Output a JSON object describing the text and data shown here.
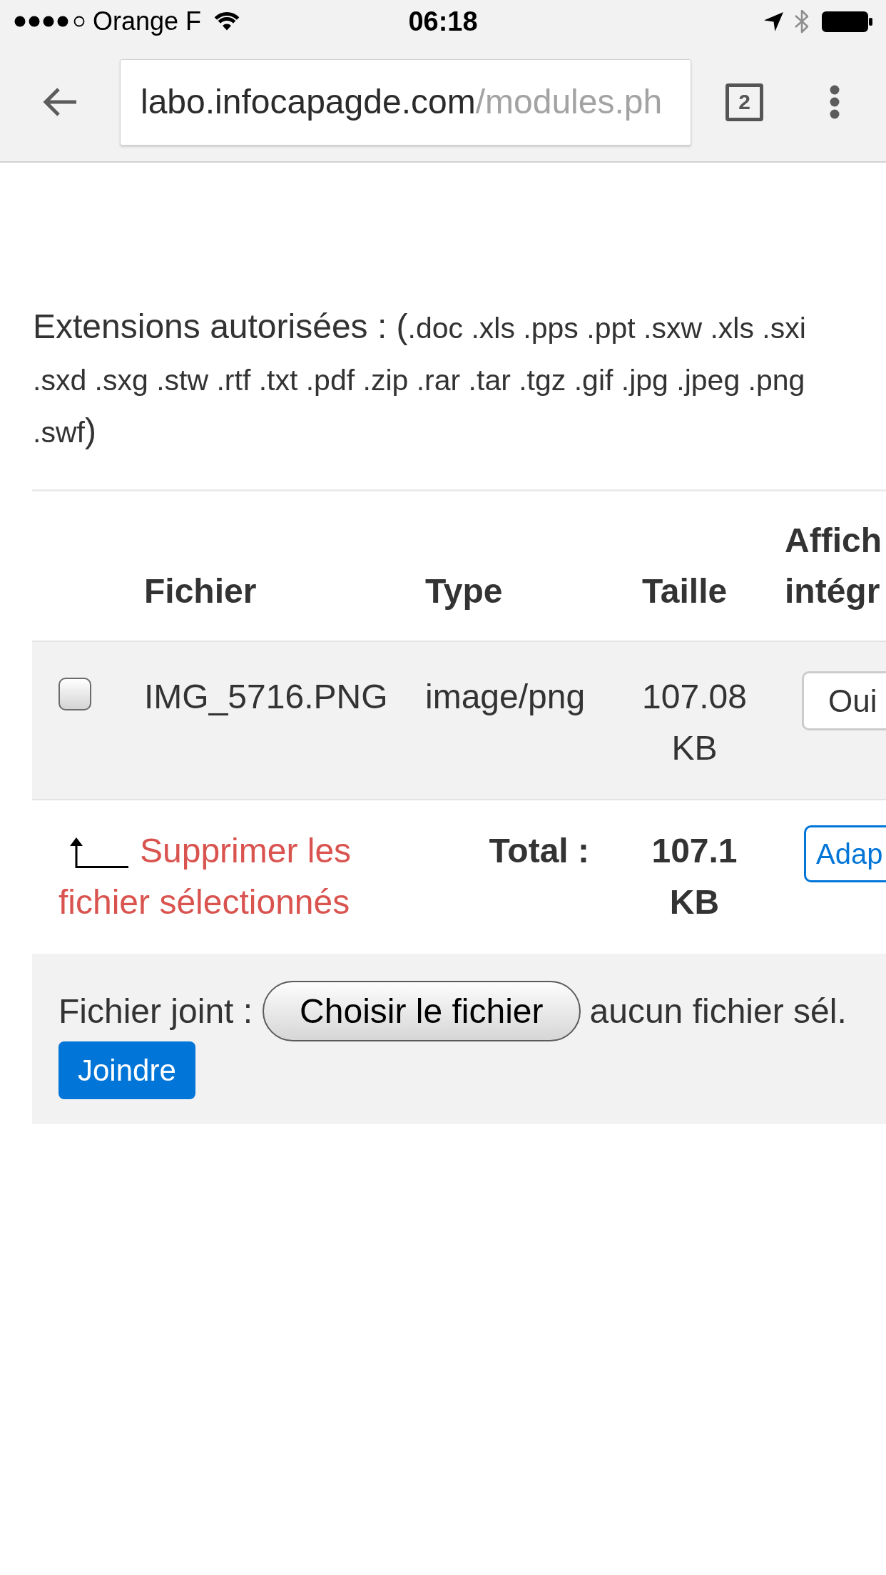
{
  "status_bar": {
    "carrier": "Orange F",
    "time": "06:18"
  },
  "browser": {
    "url": {
      "host": "labo.infocapagde.com",
      "path": "/modules.ph"
    },
    "tab_count": "2"
  },
  "extensions": {
    "label": "Extensions autorisées : (",
    "list": ".doc .xls .pps .ppt .sxw .xls .sxi .sxd .sxg .stw .rtf .txt .pdf .zip .rar .tar .tgz .gif .jpg .jpeg .png .swf",
    "closing": ")"
  },
  "table": {
    "columns": [
      "Fichier",
      "Type",
      "Taille",
      "Affich intégr"
    ],
    "rows": [
      {
        "checked": false,
        "file": "IMG_5716.PNG",
        "type": "image/png",
        "size": "107.08 KB",
        "button": "Oui"
      }
    ],
    "footer": {
      "delete_link": "Supprimer les fichier sélectionnés",
      "total_label": "Total :",
      "total": "107.1 KB",
      "button": "Adap"
    }
  },
  "upload": {
    "label": "Fichier joint :",
    "choose_button": "Choisir le fichier",
    "file_status": "aucun fichier sél.",
    "submit_button": "Joindre"
  }
}
